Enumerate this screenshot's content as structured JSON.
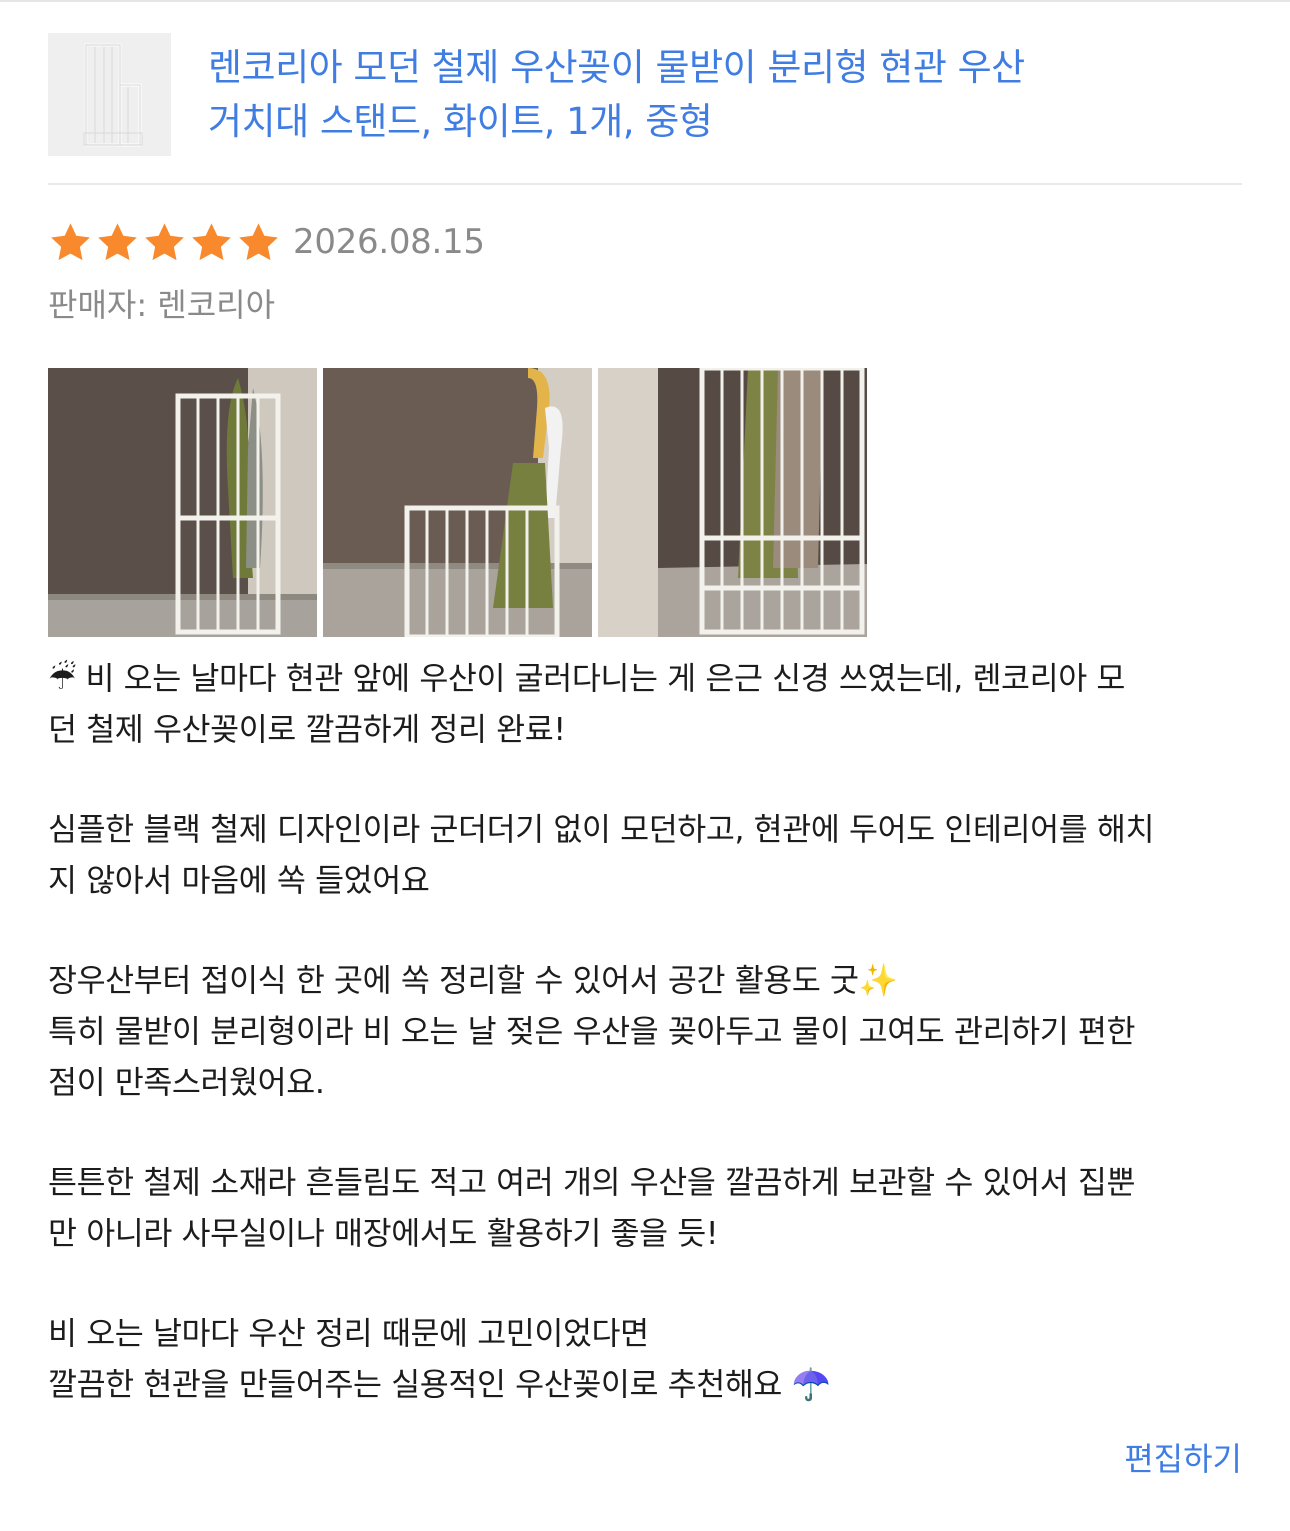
{
  "product": {
    "title_lines": [
      "렌코리아 모던 철제 우산꽂이 물받이 분리형 현관 우산",
      "거치대 스탠드, 화이트, 1개, 중형"
    ],
    "thumbnail_icon": "umbrella-stand-product-image"
  },
  "review": {
    "rating": 5,
    "rating_max": 5,
    "star_color": "#f8892d",
    "date": "2026.08.15",
    "seller": "판매자: 렌코리아",
    "photos": [
      "review-photo-1",
      "review-photo-2",
      "review-photo-3"
    ],
    "paragraphs": [
      [
        "☔ 비 오는 날마다 현관 앞에 우산이 굴러다니는 게 은근 신경 쓰였는데, 렌코리아 모",
        "던 철제 우산꽂이로 깔끔하게 정리 완료!"
      ],
      [
        "심플한 블랙 철제 디자인이라 군더더기 없이 모던하고, 현관에 두어도 인테리어를 해치",
        "지 않아서 마음에 쏙 들었어요"
      ],
      [
        "장우산부터 접이식 한 곳에 쏙 정리할 수 있어서 공간 활용도 굿✨",
        "특히 물받이 분리형이라 비 오는 날 젖은 우산을 꽂아두고 물이 고여도 관리하기 편한",
        "점이 만족스러웠어요."
      ],
      [
        "튼튼한 철제 소재라 흔들림도 적고 여러 개의 우산을 깔끔하게 보관할 수 있어서 집뿐",
        "만 아니라 사무실이나 매장에서도 활용하기 좋을 듯!"
      ],
      [
        "비 오는 날마다 우산 정리 때문에 고민이었다면",
        "깔끔한 현관을 만들어주는 실용적인 우산꽂이로 추천해요 ☂️"
      ]
    ]
  },
  "actions": {
    "edit_label": "편집하기",
    "link_color": "#3f7de3"
  }
}
